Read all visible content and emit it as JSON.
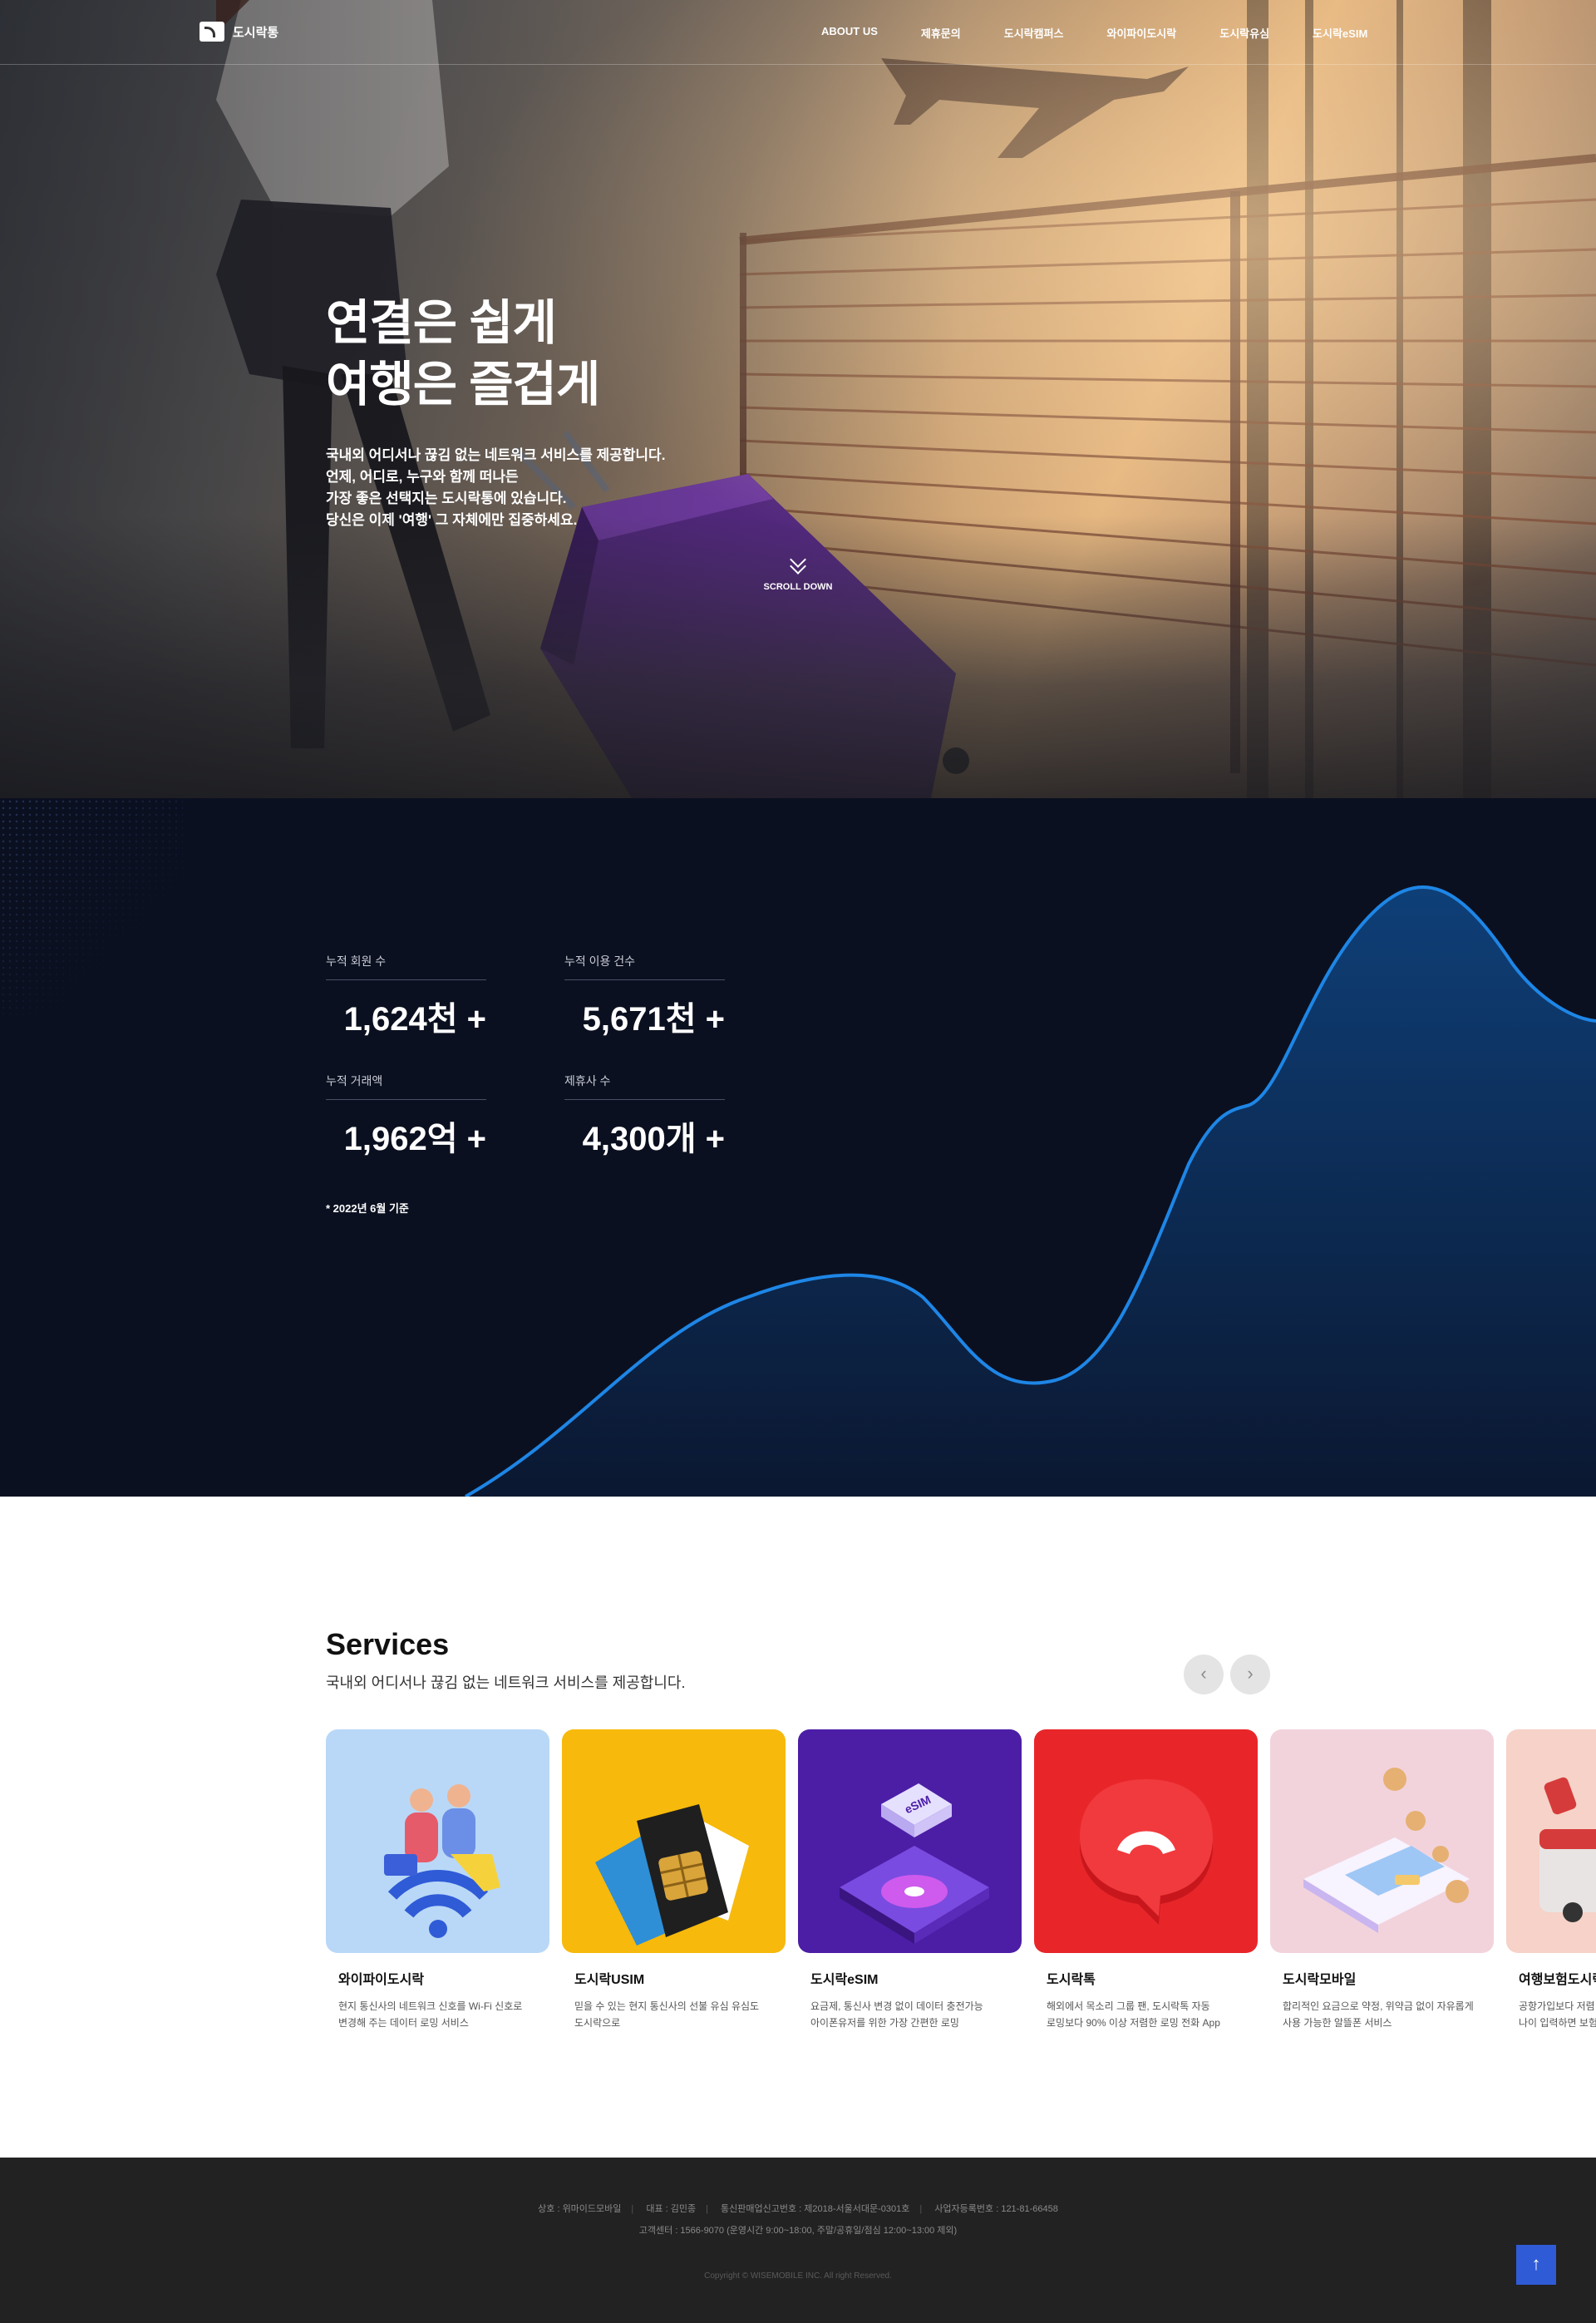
{
  "header": {
    "logo_text": "도시락통",
    "menu": [
      "ABOUT US",
      "제휴문의",
      "도시락캠퍼스",
      "와이파이도시락",
      "도시락유심",
      "도시락eSIM"
    ]
  },
  "hero": {
    "title_line1": "연결은 쉽게",
    "title_line2": "여행은 즐겁게",
    "desc_lines": [
      "국내외 어디서나 끊김 없는 네트워크 서비스를 제공합니다.",
      "언제, 어디로, 누구와 함께 떠나든",
      "가장 좋은 선택지는 도시락통에 있습니다.",
      "당신은 이제 '여행' 그 자체에만 집중하세요."
    ],
    "scroll_label": "SCROLL DOWN"
  },
  "stats": {
    "items": [
      {
        "label": "누적 회원 수",
        "value": "1,624천 +"
      },
      {
        "label": "누적 이용 건수",
        "value": "5,671천 +"
      },
      {
        "label": "누적 거래액",
        "value": "1,962억 +"
      },
      {
        "label": "제휴사 수",
        "value": "4,300개 +"
      }
    ],
    "note": "* 2022년 6월 기준"
  },
  "services": {
    "title": "Services",
    "subtitle": "국내외 어디서나 끊김 없는 네트워크 서비스를 제공합니다.",
    "prev_icon": "‹",
    "next_icon": "›",
    "cards": [
      {
        "name": "와이파이도시락",
        "desc": "현지 통신사의 네트워크 신호를 Wi-Fi 신호로\n변경해 주는 데이터 로밍 서비스",
        "bg": "#b9d8f7"
      },
      {
        "name": "도시락USIM",
        "desc": "믿을 수 있는 현지 통신사의 선불 유심 유심도\n도시락으로",
        "bg": "#f7b90b"
      },
      {
        "name": "도시락eSIM",
        "desc": "요금제, 통신사 변경 없이 데이터 충전가능\n아이폰유저를 위한 가장 간편한 로밍",
        "bg": "#4c1ea6"
      },
      {
        "name": "도시락톡",
        "desc": "해외에서 목소리 그룹 팬, 도시락톡 자동\n로밍보다 90% 이상 저렴한 로밍 전화 App",
        "bg": "#e8262a"
      },
      {
        "name": "도시락모바일",
        "desc": "합리적인 요금으로 약정, 위약금 없이 자유롭게\n사용 가능한 알뜰폰 서비스",
        "bg": "#f2d3dc"
      },
      {
        "name": "여행보험도시락",
        "desc": "공항가입보다 저렴\n나이 입력하면 보험",
        "bg": "#f6d2c8"
      }
    ]
  },
  "footer": {
    "company": "상호 : 위마이드모바일",
    "ceo": "대표 : 김민종",
    "license": "통신판매업신고번호 : 제2018-서울서대문-0301호",
    "biz_no": "사업자등록번호 : 121-81-66458",
    "cs": "고객센터 : 1566-9070 (운영시간 9:00~18:00, 주말/공휴일/점심 12:00~13:00 제외)",
    "copyright": "Copyright © WISEMOBILE INC. All right Reserved.",
    "top_icon": "↑"
  },
  "colors": {
    "stats_bg": "#0b1020",
    "wave_stroke": "#1e86e6",
    "top_button": "#2f5bd7",
    "footer_bg": "#222222"
  }
}
